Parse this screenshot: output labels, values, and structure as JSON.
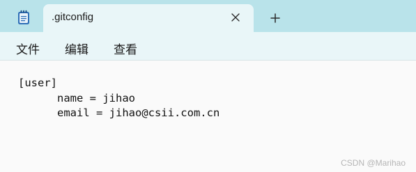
{
  "app": {
    "icon": "notepad-icon"
  },
  "tab": {
    "title": ".gitconfig",
    "close_icon": "close-icon"
  },
  "new_tab_icon": "plus-icon",
  "menu": {
    "items": [
      "文件",
      "编辑",
      "查看"
    ]
  },
  "editor": {
    "lines": [
      "[user]",
      "\tname = jihao",
      "\temail = jihao@csii.com.cn"
    ]
  },
  "watermark": "CSDN @Marihao",
  "colors": {
    "tabstrip": "#b9e3ea",
    "tab_active": "#e9f6f8",
    "editor_bg": "#fafafa"
  }
}
